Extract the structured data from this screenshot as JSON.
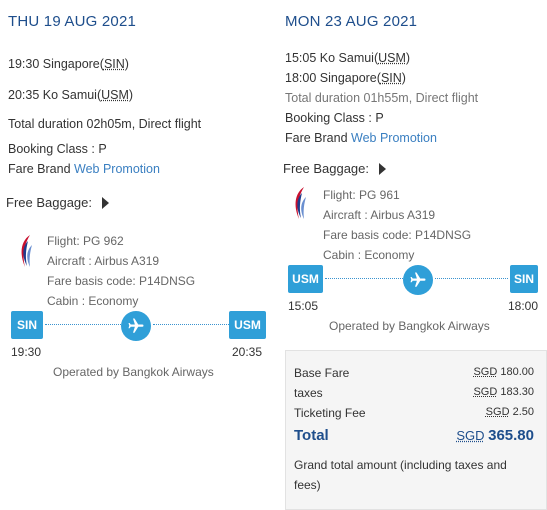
{
  "outbound": {
    "date": "THU 19 AUG 2021",
    "dep_time": "19:30",
    "dep_city": "Singapore",
    "dep_code": "SIN",
    "arr_time": "20:35",
    "arr_city": "Ko Samui",
    "arr_code": "USM",
    "duration": "Total duration 02h05m, Direct flight",
    "booking_class": "Booking Class : P",
    "fare_brand_label": "Fare Brand",
    "fare_brand_value": "Web Promotion",
    "baggage_label": "Free Baggage:",
    "flight": "Flight: PG 962",
    "aircraft": "Aircraft : Airbus A319",
    "fare_basis": "Fare basis code: P14DNSG",
    "cabin": "Cabin : Economy",
    "route_from": "SIN",
    "route_to": "USM",
    "route_dep_time": "19:30",
    "route_arr_time": "20:35",
    "operated_by": "Operated by Bangkok Airways"
  },
  "inbound": {
    "date": "MON 23 AUG 2021",
    "dep_time": "15:05",
    "dep_city": "Ko Samui",
    "dep_code": "USM",
    "arr_time": "18:00",
    "arr_city": "Singapore",
    "arr_code": "SIN",
    "duration": "Total duration 01h55m, Direct flight",
    "booking_class": "Booking Class : P",
    "fare_brand_label": "Fare Brand",
    "fare_brand_value": "Web Promotion",
    "baggage_label": "Free Baggage:",
    "flight": "Flight: PG 961",
    "aircraft": "Aircraft : Airbus A319",
    "fare_basis": "Fare basis code: P14DNSG",
    "cabin": "Cabin : Economy",
    "route_from": "USM",
    "route_to": "SIN",
    "route_dep_time": "15:05",
    "route_arr_time": "18:00",
    "operated_by": "Operated by Bangkok Airways"
  },
  "fare": {
    "currency": "SGD",
    "base_label": "Base Fare",
    "base_value": "180.00",
    "taxes_label": "taxes",
    "taxes_value": "183.30",
    "ticketing_label": "Ticketing Fee",
    "ticketing_value": "2.50",
    "total_label": "Total",
    "total_value": "365.80",
    "grand_total_note": "Grand total amount (including taxes and fees)"
  },
  "colors": {
    "accent": "#2f9fd8",
    "heading": "#1e4e8c",
    "link": "#3a7fc1"
  },
  "icons": {
    "airline_logo": "bangkok-airways-logo",
    "baggage_toggle": "caret-right-icon",
    "plane": "airplane-icon"
  }
}
